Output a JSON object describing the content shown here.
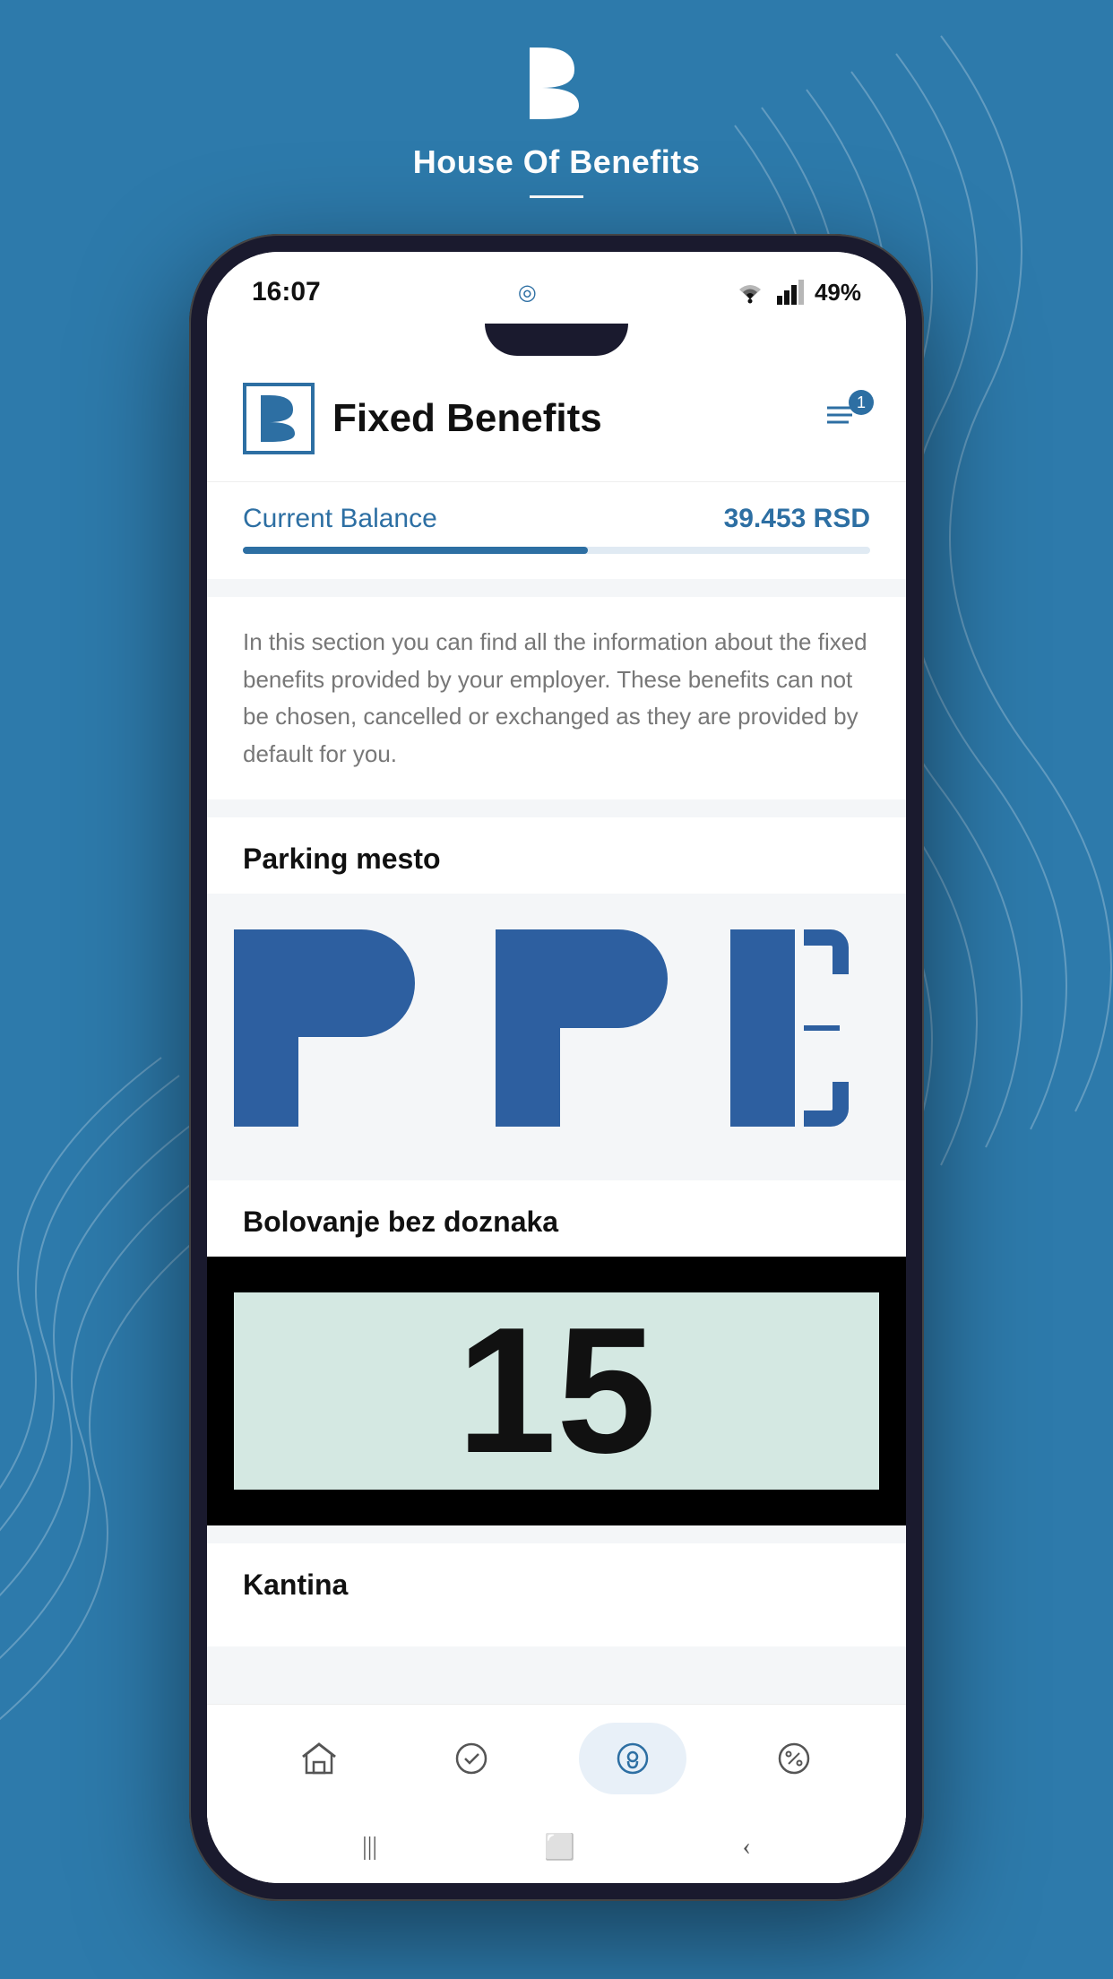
{
  "brand": {
    "logo_letter": "B",
    "title": "House Of Benefits",
    "divider": true
  },
  "status_bar": {
    "time": "16:07",
    "navigator_icon": "◎",
    "wifi": "WiFi",
    "signal": "Signal",
    "battery": "49%"
  },
  "app_header": {
    "logo_letter": "B",
    "title": "Fixed Benefits",
    "notification_count": "1"
  },
  "balance": {
    "label": "Current Balance",
    "value": "39.453 RSD",
    "progress_percent": 55
  },
  "description": {
    "text": "In this section you can find all the information about the fixed benefits provided by your employer. These benefits can not be chosen, cancelled or exchanged as they are provided by default for you."
  },
  "benefits": [
    {
      "id": "parking",
      "title": "Parking mesto",
      "image_type": "parking"
    },
    {
      "id": "sick-leave",
      "title": "Bolovanje bez doznaka",
      "image_type": "sick"
    },
    {
      "id": "kantina",
      "title": "Kantina",
      "image_type": "none"
    }
  ],
  "sick_number": "15",
  "bottom_nav": {
    "items": [
      {
        "id": "home",
        "icon": "⌂",
        "active": false
      },
      {
        "id": "badge",
        "icon": "✿",
        "active": false
      },
      {
        "id": "lock",
        "icon": "⊕",
        "active": true
      },
      {
        "id": "percent",
        "icon": "%",
        "active": false
      }
    ]
  },
  "android_nav": {
    "back": "|||",
    "home": "⬜",
    "recent": "‹"
  }
}
